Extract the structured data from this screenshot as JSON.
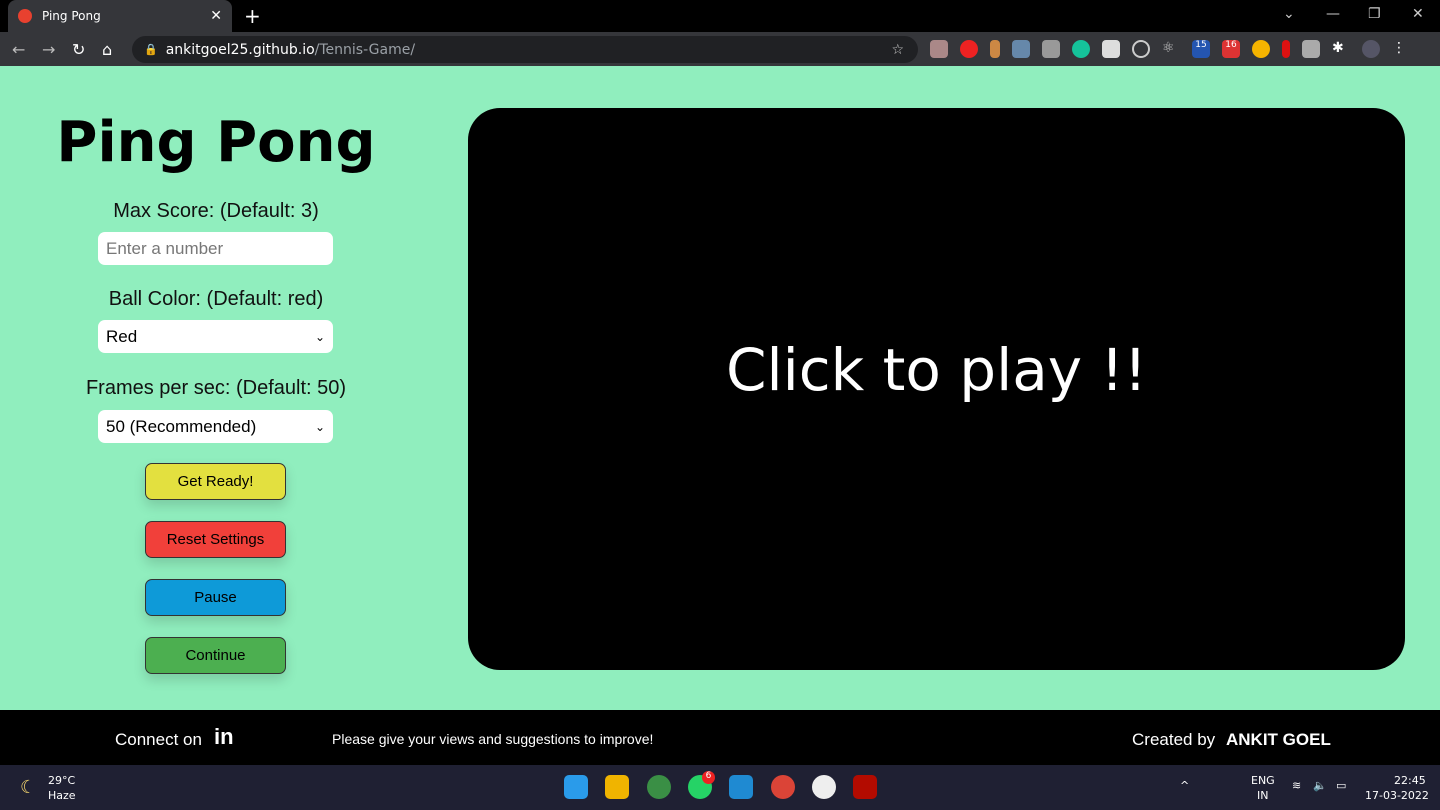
{
  "browser": {
    "tab_title": "Ping Pong",
    "url_host": "ankitgoel25.github.io",
    "url_path": "/Tennis-Game/",
    "extensions": [
      "owl",
      "hand-stop",
      "pin",
      "pen",
      "camera",
      "grammarly",
      "pip",
      "target",
      "react",
      "days-until",
      "gmail",
      "compass",
      "marker",
      "touch",
      "puzzle",
      "avatar"
    ],
    "badges": {
      "days": "15",
      "mail": "16"
    }
  },
  "sidebar": {
    "title": "Ping Pong",
    "max_score_label": "Max Score: (Default: 3)",
    "max_score_placeholder": "Enter a number",
    "ball_color_label": "Ball Color: (Default: red)",
    "ball_color_value": "Red",
    "fps_label": "Frames per sec: (Default: 50)",
    "fps_value": "50 (Recommended)",
    "buttons": [
      {
        "label": "Get Ready!",
        "color": "#e3e03f"
      },
      {
        "label": "Reset Settings",
        "color": "#f1403a"
      },
      {
        "label": "Pause",
        "color": "#0e9ad8"
      },
      {
        "label": "Continue",
        "color": "#4caf50"
      }
    ]
  },
  "game": {
    "prompt": "Click to play !!"
  },
  "footer": {
    "connect": "Connect on",
    "message": "Please give your views and suggestions to improve!",
    "created_by": "Created by",
    "author": "ANKIT GOEL"
  },
  "taskbar": {
    "temp": "29°C",
    "weather": "Haze",
    "lang1": "ENG",
    "lang2": "IN",
    "time": "22:45",
    "date": "17-03-2022",
    "whatsapp_badge": "6"
  }
}
